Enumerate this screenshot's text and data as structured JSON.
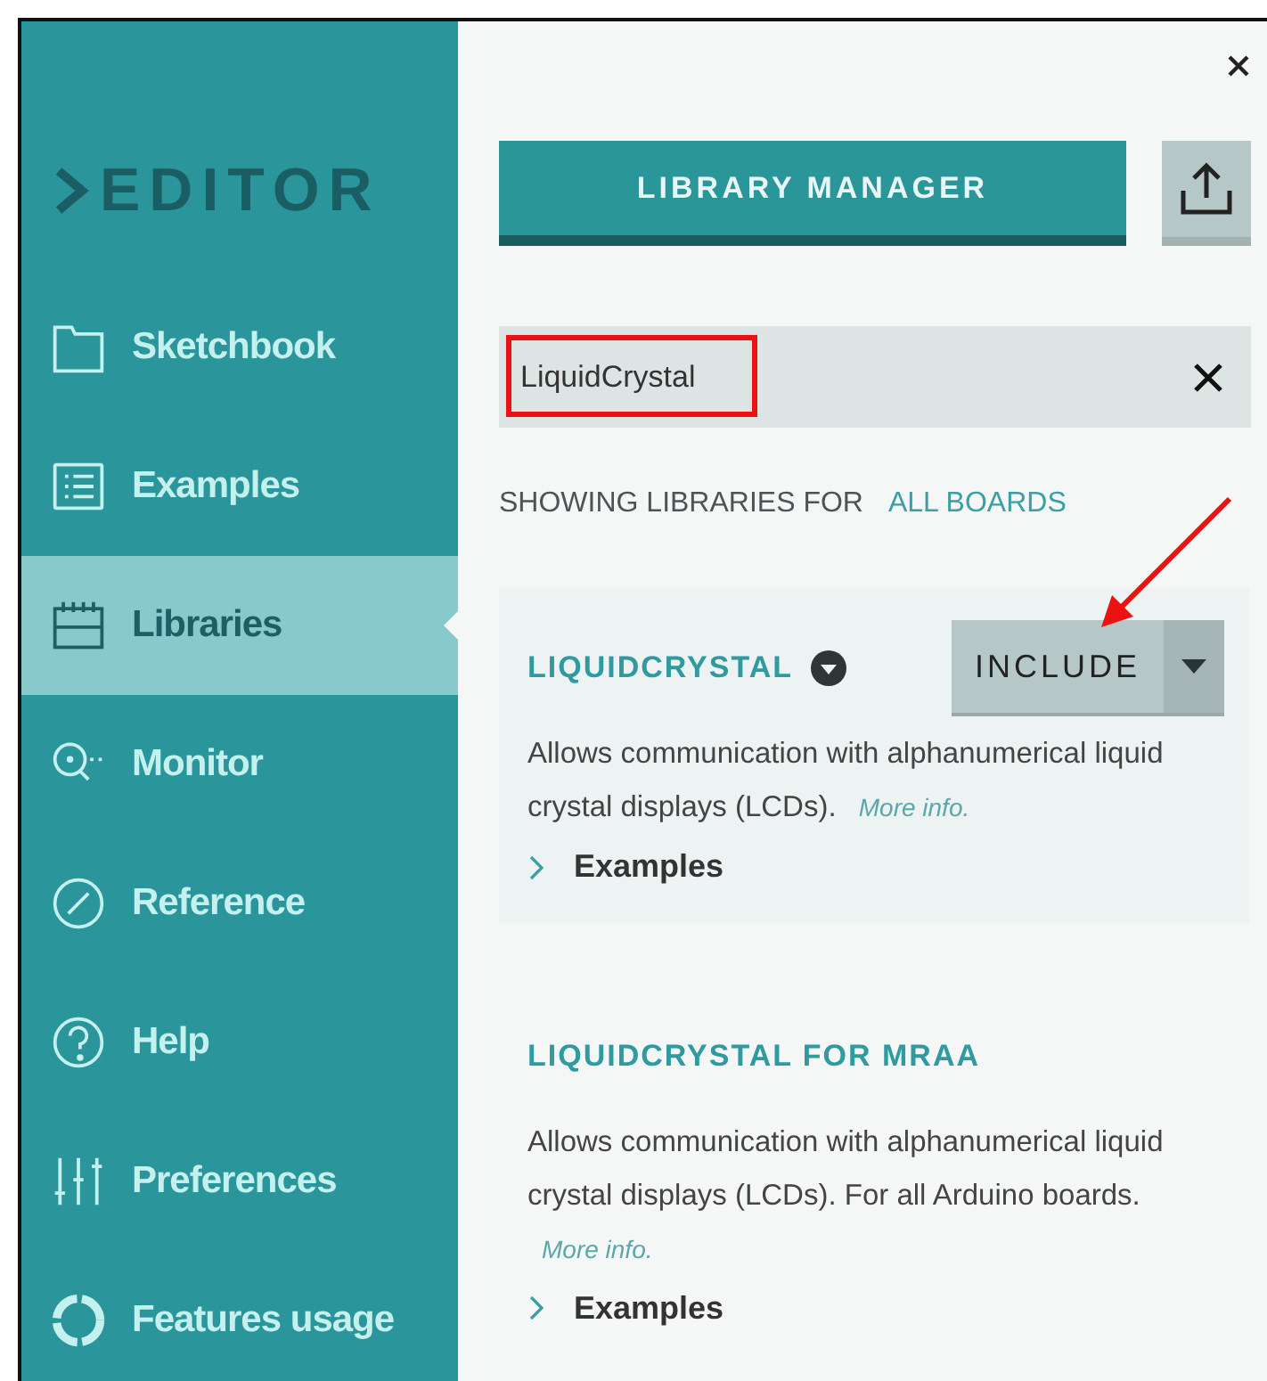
{
  "logo": {
    "text": "EDITOR"
  },
  "sidebar": {
    "items": [
      {
        "label": "Sketchbook",
        "selected": false
      },
      {
        "label": "Examples",
        "selected": false
      },
      {
        "label": "Libraries",
        "selected": true
      },
      {
        "label": "Monitor",
        "selected": false
      },
      {
        "label": "Reference",
        "selected": false
      },
      {
        "label": "Help",
        "selected": false
      },
      {
        "label": "Preferences",
        "selected": false
      },
      {
        "label": "Features usage",
        "selected": false
      }
    ]
  },
  "panel": {
    "title_button": "LIBRARY MANAGER",
    "search": {
      "value": "LiquidCrystal"
    },
    "filter": {
      "label": "SHOWING LIBRARIES FOR",
      "value": "ALL BOARDS"
    },
    "libraries": [
      {
        "name": "LIQUIDCRYSTAL",
        "selected": true,
        "action": "INCLUDE",
        "description": "Allows communication with alphanumerical liquid crystal displays (LCDs).",
        "more_info": "More info.",
        "examples": "Examples"
      },
      {
        "name": "LIQUIDCRYSTAL FOR MRAA",
        "selected": false,
        "description": "Allows communication with alphanumerical liquid crystal displays (LCDs). For all Arduino boards.",
        "more_info": "More info.",
        "examples": "Examples"
      }
    ]
  }
}
